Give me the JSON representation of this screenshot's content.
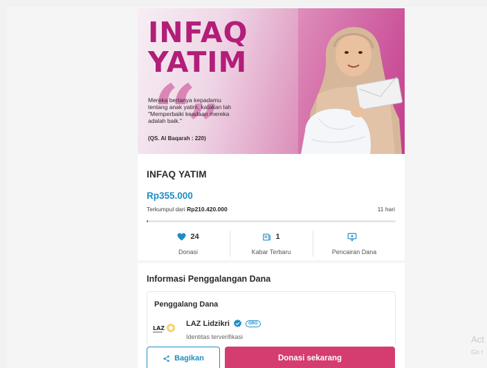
{
  "hero": {
    "back_icon": "arrow-left-icon",
    "headline_line1": "INFAQ",
    "headline_line2": "YATIM",
    "quote": "Mereka bertanya kepadamu tentang anak yatim, katakan lah \"Memperbaiki keadaan mereka adalah baik.\"",
    "reference": "(QS. Al Baqarah : 220)"
  },
  "campaign": {
    "title": "INFAQ YATIM",
    "amount": "Rp355.000",
    "collected_prefix": "Terkumpul dari ",
    "target": "Rp210.420.000",
    "days_left": "11 hari",
    "progress_fraction": 0.002
  },
  "stats": [
    {
      "icon": "heart-icon",
      "count": "24",
      "label": "Donasi"
    },
    {
      "icon": "news-icon",
      "count": "1",
      "label": "Kabar Terbaru"
    },
    {
      "icon": "withdraw-icon",
      "count": "",
      "label": "Pencairan Dana"
    }
  ],
  "fundraiser": {
    "section_title": "Informasi Penggalangan Dana",
    "card_title": "Penggalang Dana",
    "org_name": "LAZ Lidzikri",
    "org_badge": "ORG",
    "org_status": "Identitas terverifikasi",
    "logo_text": "LAZ"
  },
  "actions": {
    "share_label": "Bagikan",
    "donate_label": "Donasi sekarang"
  },
  "colors": {
    "accent": "#1f8cc5",
    "donate": "#d53c6f",
    "brand_magenta": "#b21e78"
  },
  "watermark": {
    "line1": "Act",
    "line2": "Go t"
  }
}
